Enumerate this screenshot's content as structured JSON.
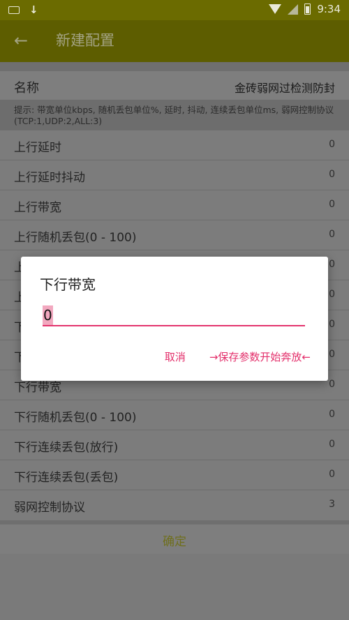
{
  "status": {
    "time": "9:34"
  },
  "appbar": {
    "back_icon": "←",
    "title": "新建配置"
  },
  "name_row": {
    "label": "名称",
    "value": "金砖弱网过检测防封"
  },
  "hint": "提示: 带宽单位kbps, 随机丢包单位%, 延时, 抖动, 连续丢包单位ms, 弱网控制协议(TCP:1,UDP:2,ALL:3)",
  "rows": [
    {
      "label": "上行延时",
      "value": "0"
    },
    {
      "label": "上行延时抖动",
      "value": "0"
    },
    {
      "label": "上行带宽",
      "value": "0"
    },
    {
      "label": "上行随机丢包(0 - 100)",
      "value": "0"
    },
    {
      "label": "上",
      "value": "0"
    },
    {
      "label": "上",
      "value": "0"
    },
    {
      "label": "下",
      "value": "0"
    },
    {
      "label": "下",
      "value": "0"
    },
    {
      "label": "下行带宽",
      "value": "0"
    },
    {
      "label": "下行随机丢包(0 - 100)",
      "value": "0"
    },
    {
      "label": "下行连续丢包(放行)",
      "value": "0"
    },
    {
      "label": "下行连续丢包(丢包)",
      "value": "0"
    },
    {
      "label": "弱网控制协议",
      "value": "3"
    }
  ],
  "confirm_label": "确定",
  "dialog": {
    "title": "下行带宽",
    "input_value": "0",
    "cancel": "取消",
    "ok": "→保存参数开始奔放←"
  },
  "colors": {
    "accent": "#e3336d",
    "toolbar": "#5d5d00"
  }
}
